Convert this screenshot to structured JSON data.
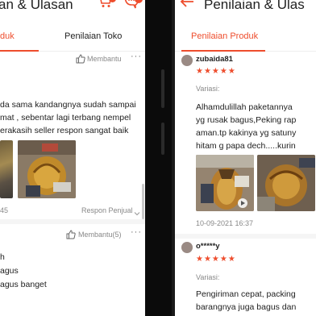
{
  "left": {
    "title": "an & Ulasan",
    "tabs": [
      "duk",
      "Penilaian Toko"
    ],
    "review1": {
      "helpful_label": "Membantu",
      "text_lines": [
        "da sama kandangnya sudah sampai",
        "mat , sebentar lagi terbang nempel",
        "erakasih seller respon sangat baik"
      ],
      "time": "45",
      "seller_reply": "Respon Penjual"
    },
    "review2": {
      "helpful_label": "Membantu(5)",
      "text_lines": [
        "h",
        "agus",
        "agus banget"
      ]
    }
  },
  "right": {
    "title": "Penilaian & Ulas",
    "active_tab": "Penilaian Produk",
    "review1": {
      "username": "zubaida81",
      "stars": "★★★★★",
      "variant_label": "Variasi:",
      "text_lines": [
        "Alhamdulillah paketannya",
        "yg rusak bagus,Peking rap",
        "aman.tp kakinya yg satuny",
        "hitam g papa dech.....kurin"
      ],
      "date": "10-09-2021 16:37"
    },
    "review2": {
      "username": "o*****y",
      "stars": "★★★★★",
      "variant_label": "Variasi:",
      "text_lines": [
        "Pengiriman cepat, packing",
        "barangnya juga bagus dan"
      ]
    }
  },
  "colors": {
    "accent": "#ee4d2d"
  }
}
